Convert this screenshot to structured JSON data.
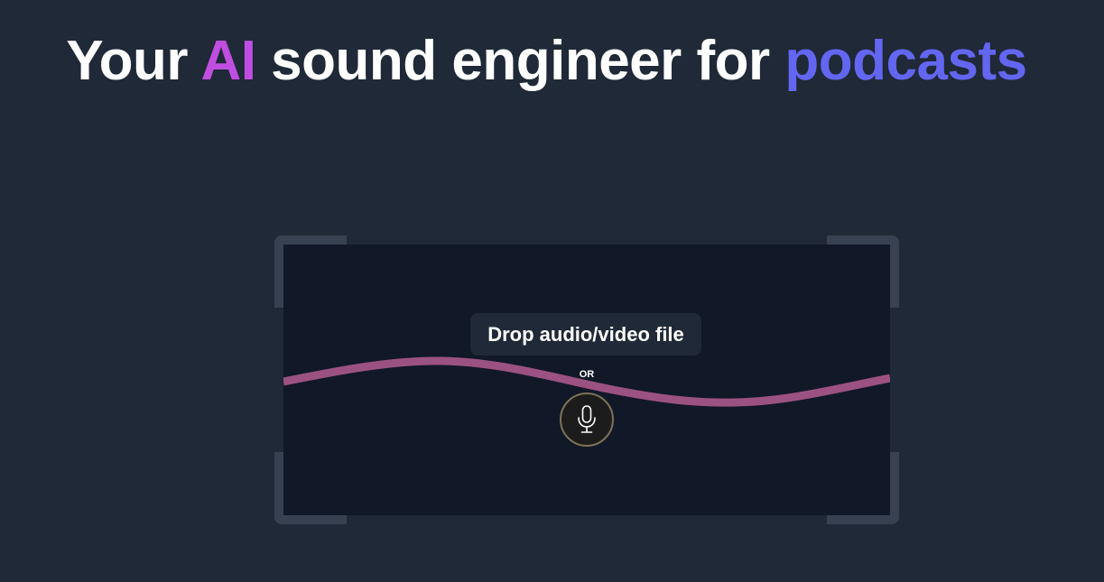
{
  "hero": {
    "headline_part1": "Your ",
    "headline_highlight1": "AI",
    "headline_part2": " sound engineer for ",
    "headline_highlight2": "podcasts"
  },
  "dropzone": {
    "drop_label": "Drop audio/video file",
    "or_label": "OR",
    "mic_icon": "microphone-icon"
  },
  "colors": {
    "background": "#1f2937",
    "dropzone_background": "#111827",
    "ai_highlight": "#c04ee0",
    "podcasts_highlight": "#6366f1",
    "wave": "#9b5282",
    "frame": "#374151",
    "mic_border": "#7c7358"
  }
}
